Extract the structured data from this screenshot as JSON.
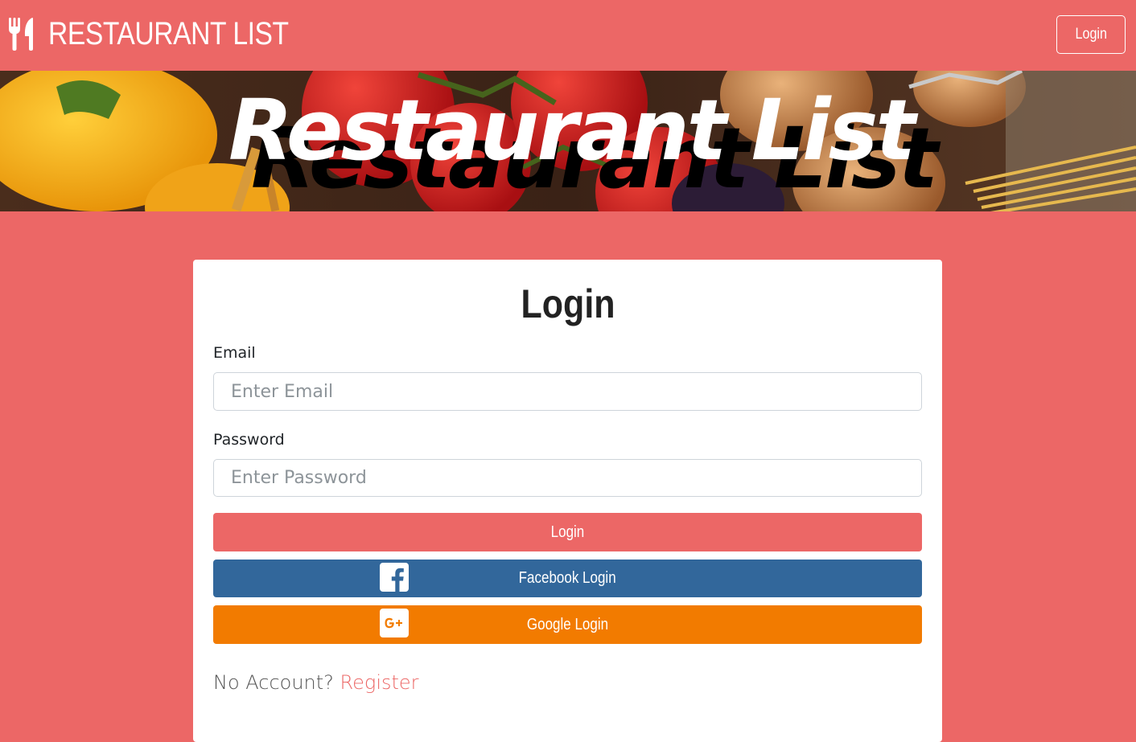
{
  "navbar": {
    "brand_icon": "utensils-icon",
    "brand_text": "RESTAURANT LIST",
    "login_label": "Login"
  },
  "banner": {
    "title": "Restaurant List"
  },
  "login_form": {
    "title": "Login",
    "email": {
      "label": "Email",
      "placeholder": "Enter Email",
      "value": ""
    },
    "password": {
      "label": "Password",
      "placeholder": "Enter Password",
      "value": ""
    },
    "login_button": "Login",
    "facebook_button": {
      "label": "Facebook Login",
      "icon": "facebook-icon"
    },
    "google_button": {
      "label": "Google Login",
      "icon": "google-plus-icon"
    },
    "register_prompt": "No Account?",
    "register_link": "Register"
  },
  "colors": {
    "accent": "#ec6766",
    "facebook": "#32679b",
    "google": "#f27b00",
    "card": "#ffffff"
  }
}
